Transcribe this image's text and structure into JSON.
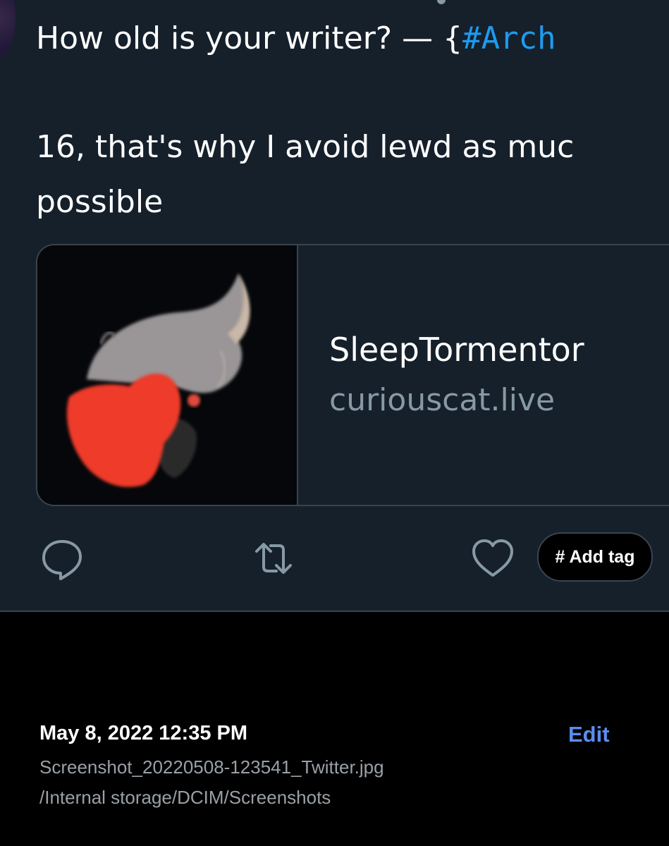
{
  "tweet": {
    "question_text": "How old is your writer? — {",
    "hashtag_text": "#Arch",
    "answer_line1": "16, that's why I avoid lewd as muc",
    "answer_line2": "possible"
  },
  "card": {
    "title": "SleepTormentor",
    "domain": "curiouscat.live",
    "thumbnail_icon": "red-masked-character-artwork"
  },
  "actions": {
    "reply_icon": "speech-bubble-icon",
    "retweet_icon": "retweet-arrows-icon",
    "like_icon": "heart-icon",
    "add_tag_label": "# Add tag"
  },
  "file_info": {
    "date": "May 8, 2022 12:35 PM",
    "edit_label": "Edit",
    "filename": "Screenshot_20220508-123541_Twitter.jpg",
    "path": "/Internal storage/DCIM/Screenshots"
  },
  "colors": {
    "tweet_background": "#15202b",
    "hashtag": "#1d9bf0",
    "secondary_text": "#8899a6",
    "edit_link": "#5b8def",
    "page_background": "#000000"
  }
}
